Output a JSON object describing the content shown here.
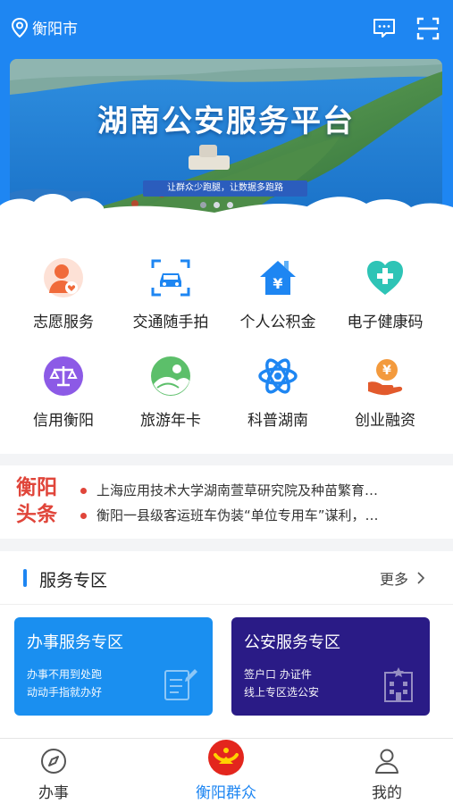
{
  "topbar": {
    "city": "衡阳市",
    "message_icon": "message-icon",
    "scan_icon": "scan-icon"
  },
  "banner": {
    "title": "湖南公安服务平台",
    "subtitle": "让群众少跑腿，让数据多跑路"
  },
  "services_grid": [
    {
      "label": "志愿服务",
      "icon": "volunteer-icon"
    },
    {
      "label": "交通随手拍",
      "icon": "car-camera-icon"
    },
    {
      "label": "个人公积金",
      "icon": "housing-fund-icon"
    },
    {
      "label": "电子健康码",
      "icon": "health-code-icon"
    },
    {
      "label": "信用衡阳",
      "icon": "credit-scale-icon"
    },
    {
      "label": "旅游年卡",
      "icon": "travel-card-icon"
    },
    {
      "label": "科普湖南",
      "icon": "atom-icon"
    },
    {
      "label": "创业融资",
      "icon": "finance-icon"
    }
  ],
  "headlines": {
    "tag_line1": "衡阳",
    "tag_line2": "头条",
    "items": [
      "上海应用技术大学湖南萱草研究院及种苗繁育…",
      "衡阳一县级客运班车伪装“单位专用车”谋利，…"
    ]
  },
  "service_zone": {
    "title": "服务专区",
    "more": "更多",
    "cards": [
      {
        "title": "办事服务专区",
        "line1": "办事不用到处跑",
        "line2": "动动手指就办好"
      },
      {
        "title": "公安服务专区",
        "line1": "签户口 办证件",
        "line2": "线上专区选公安"
      }
    ]
  },
  "bottom_nav": [
    {
      "label": "办事"
    },
    {
      "label": "衡阳群众"
    },
    {
      "label": "我的"
    }
  ],
  "colors": {
    "primary": "#1e86f2",
    "headline_red": "#e0453a",
    "card_purple": "#2a1b86"
  }
}
